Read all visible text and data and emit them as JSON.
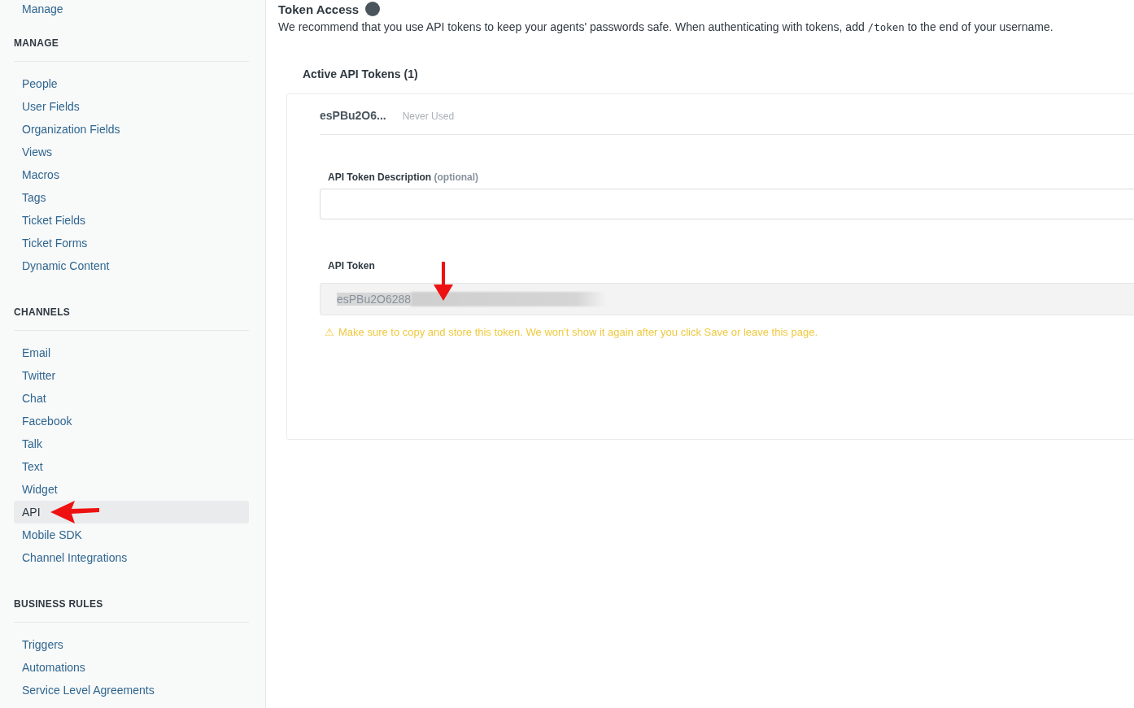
{
  "sidebar": {
    "top_link": "Manage",
    "sections": [
      {
        "title": "MANAGE",
        "items": [
          {
            "label": "People",
            "selected": false
          },
          {
            "label": "User Fields",
            "selected": false
          },
          {
            "label": "Organization Fields",
            "selected": false
          },
          {
            "label": "Views",
            "selected": false
          },
          {
            "label": "Macros",
            "selected": false
          },
          {
            "label": "Tags",
            "selected": false
          },
          {
            "label": "Ticket Fields",
            "selected": false
          },
          {
            "label": "Ticket Forms",
            "selected": false
          },
          {
            "label": "Dynamic Content",
            "selected": false
          }
        ]
      },
      {
        "title": "CHANNELS",
        "items": [
          {
            "label": "Email",
            "selected": false
          },
          {
            "label": "Twitter",
            "selected": false
          },
          {
            "label": "Chat",
            "selected": false
          },
          {
            "label": "Facebook",
            "selected": false
          },
          {
            "label": "Talk",
            "selected": false
          },
          {
            "label": "Text",
            "selected": false
          },
          {
            "label": "Widget",
            "selected": false
          },
          {
            "label": "API",
            "selected": true
          },
          {
            "label": "Mobile SDK",
            "selected": false
          },
          {
            "label": "Channel Integrations",
            "selected": false
          }
        ]
      },
      {
        "title": "BUSINESS RULES",
        "items": [
          {
            "label": "Triggers",
            "selected": false
          },
          {
            "label": "Automations",
            "selected": false
          },
          {
            "label": "Service Level Agreements",
            "selected": false
          }
        ]
      }
    ]
  },
  "main": {
    "heading": "Token Access",
    "intro_before": "We recommend that you use API tokens to keep your agents' passwords safe. When authenticating with tokens, add",
    "intro_code": "/token",
    "intro_after": "to the end of your username.",
    "tokens_title": "Active API Tokens (1)",
    "token": {
      "name": "esPBu2O6...",
      "usage": "Never Used"
    },
    "description_label": "API Token Description",
    "description_hint": "(optional)",
    "token_label": "API Token",
    "token_value": "esPBu2O6288",
    "warning_icon": "⚠",
    "warning": "Make sure to copy and store this token. We won't show it again after you click Save or leave this page."
  }
}
